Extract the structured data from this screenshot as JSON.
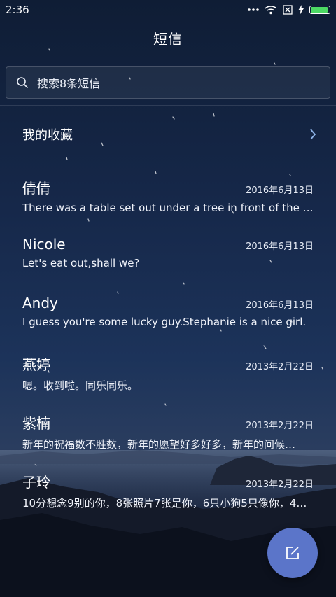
{
  "status_bar": {
    "time": "2:36",
    "icons": [
      "dots-icon",
      "wifi-icon",
      "sim-off-icon",
      "charging-icon",
      "battery-icon"
    ],
    "battery_color": "#4cd964"
  },
  "header": {
    "title": "短信"
  },
  "search": {
    "placeholder": "搜索8条短信"
  },
  "favorites": {
    "label": "我的收藏"
  },
  "threads": [
    {
      "name": "倩倩",
      "date": "2016年6月13日",
      "preview": "There was a table set out under a tree in front of the ho…"
    },
    {
      "name": "Nicole",
      "date": "2016年6月13日",
      "preview": "Let's eat out,shall we?"
    },
    {
      "name": "Andy",
      "date": "2016年6月13日",
      "preview": "I guess you're some lucky guy.Stephanie is a nice girl."
    },
    {
      "name": "燕婷",
      "date": "2013年2月22日",
      "preview": "嗯。收到啦。同乐同乐。"
    },
    {
      "name": "紫楠",
      "date": "2013年2月22日",
      "preview": "新年的祝福数不胜数，新年的愿望好多好多，新年的问候…"
    },
    {
      "name": "子玲",
      "date": "2013年2月22日",
      "preview": "10分想念9别的你，8张照片7张是你，6只小狗5只像你，4…"
    }
  ],
  "fab": {
    "icon": "compose-icon",
    "color": "#5b75c9"
  }
}
